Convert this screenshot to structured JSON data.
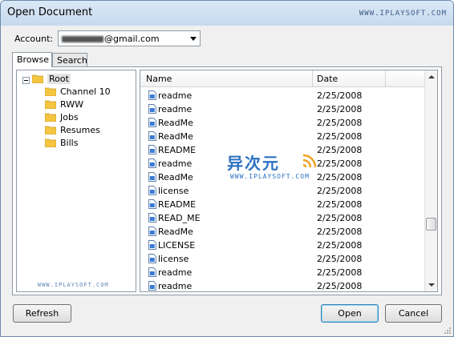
{
  "window": {
    "title": "Open Document",
    "watermark": "WWW.IPLAYSOFT.COM"
  },
  "account": {
    "label": "Account:",
    "value": "@gmail.com"
  },
  "tabs": [
    {
      "label": "Browse"
    },
    {
      "label": "Search"
    }
  ],
  "tree": {
    "root": "Root",
    "folders": [
      "Channel 10",
      "RWW",
      "Jobs",
      "Resumes",
      "Bills"
    ],
    "watermark": "WWW.IPLAYSOFT.COM"
  },
  "list": {
    "columns": [
      "Name",
      "Date"
    ],
    "rows": [
      {
        "name": "readme",
        "date": "2/25/2008"
      },
      {
        "name": "readme",
        "date": "2/25/2008"
      },
      {
        "name": "ReadMe",
        "date": "2/25/2008"
      },
      {
        "name": "ReadMe",
        "date": "2/25/2008"
      },
      {
        "name": "README",
        "date": "2/25/2008"
      },
      {
        "name": "readme",
        "date": "2/25/2008"
      },
      {
        "name": "ReadMe",
        "date": "2/25/2008"
      },
      {
        "name": "license",
        "date": "2/25/2008"
      },
      {
        "name": "README",
        "date": "2/25/2008"
      },
      {
        "name": "READ_ME",
        "date": "2/25/2008"
      },
      {
        "name": "ReadMe",
        "date": "2/25/2008"
      },
      {
        "name": "LICENSE",
        "date": "2/25/2008"
      },
      {
        "name": "license",
        "date": "2/25/2008"
      },
      {
        "name": "readme",
        "date": "2/25/2008"
      },
      {
        "name": "readme",
        "date": "2/25/2008"
      }
    ]
  },
  "overlay": {
    "cn": "异次元",
    "en": "WWW.IPLAYSOFT.COM"
  },
  "buttons": {
    "refresh": "Refresh",
    "open": "Open",
    "cancel": "Cancel"
  },
  "colors": {
    "accent": "#2b71c1",
    "folder": "#f5c542"
  }
}
